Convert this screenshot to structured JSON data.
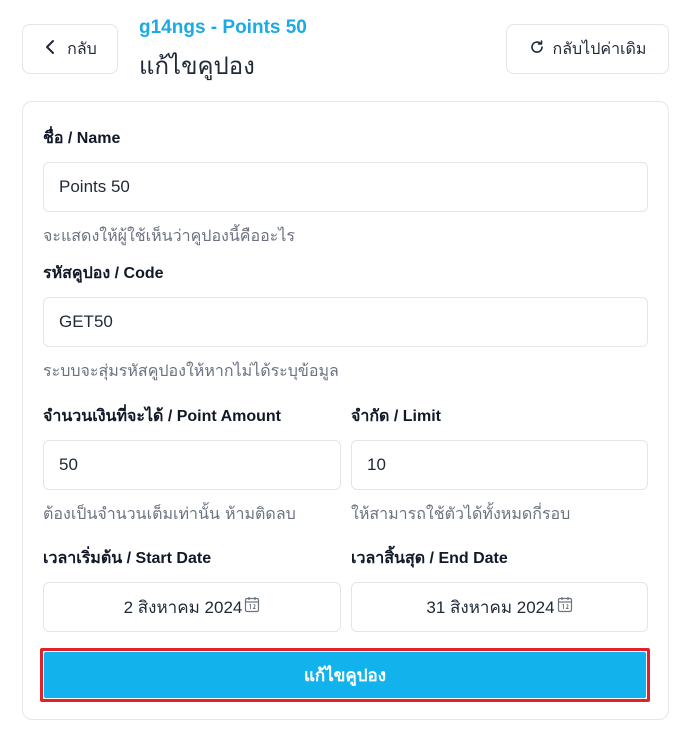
{
  "header": {
    "back_label": "กลับ",
    "subtitle": "g14ngs - Points 50",
    "title": "แก้ไขคูปอง",
    "reset_label": "กลับไปค่าเดิม"
  },
  "form": {
    "name": {
      "label": "ชื่อ / Name",
      "value": "Points 50",
      "hint": "จะแสดงให้ผู้ใช้เห็นว่าคูปองนี้คืออะไร"
    },
    "code": {
      "label": "รหัสคูปอง / Code",
      "value": "GET50",
      "hint": "ระบบจะสุ่มรหัสคูปองให้หากไม่ได้ระบุข้อมูล"
    },
    "point_amount": {
      "label": "จำนวนเงินที่จะได้ / Point Amount",
      "value": "50",
      "hint": "ต้องเป็นจำนวนเต็มเท่านั้น ห้ามติดลบ"
    },
    "limit": {
      "label": "จำกัด / Limit",
      "value": "10",
      "hint": "ให้สามารถใช้ตัวได้ทั้งหมดกี่รอบ"
    },
    "start_date": {
      "label": "เวลาเริ่มต้น / Start Date",
      "value": "2 สิงหาคม 2024"
    },
    "end_date": {
      "label": "เวลาสิ้นสุด / End Date",
      "value": "31 สิงหาคม 2024"
    },
    "submit_label": "แก้ไขคูปอง"
  },
  "icons": {
    "back": "chevron-left-icon",
    "reset": "refresh-icon",
    "calendar": "calendar-icon"
  },
  "colors": {
    "accent": "#12b3ec",
    "subtitle": "#1aaae5",
    "highlight_border": "#e0232b"
  }
}
